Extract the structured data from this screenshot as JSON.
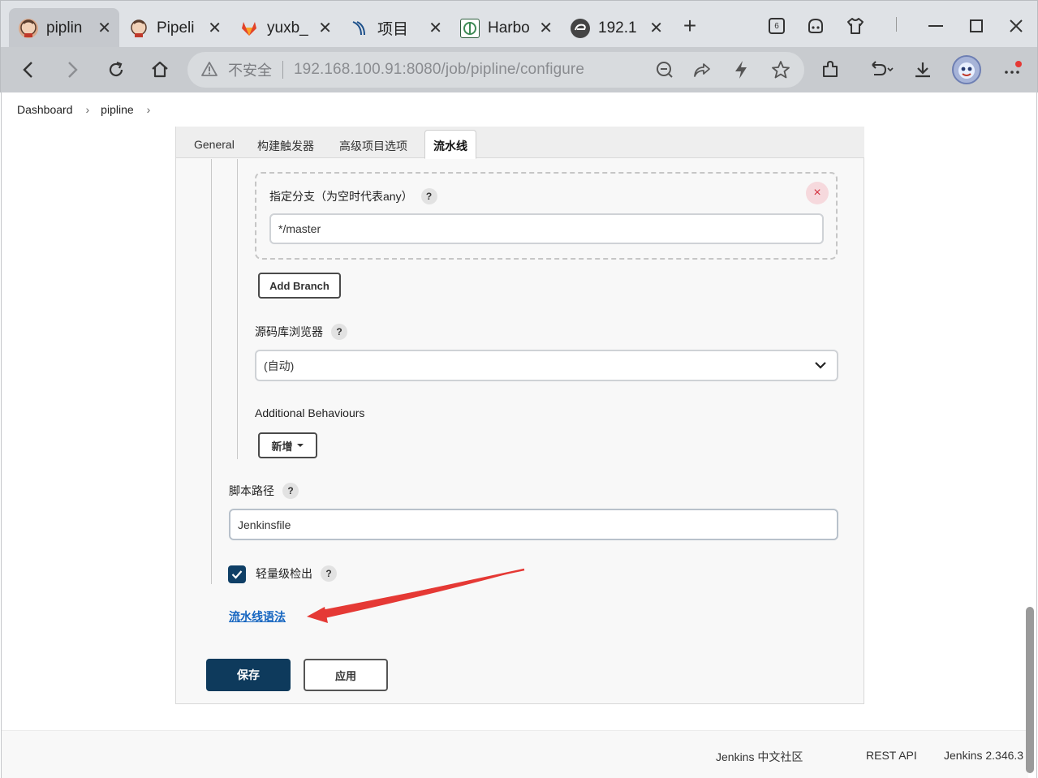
{
  "browser": {
    "tabs": [
      {
        "title": "piplin",
        "active": true,
        "icon": "jenkins-icon"
      },
      {
        "title": "Pipeli",
        "active": false,
        "icon": "jenkins-icon"
      },
      {
        "title": "yuxb_",
        "active": false,
        "icon": "gitlab-icon"
      },
      {
        "title": "项目",
        "active": false,
        "icon": "project-icon"
      },
      {
        "title": "Harbo",
        "active": false,
        "icon": "harbor-icon"
      },
      {
        "title": "192.1",
        "active": false,
        "icon": "edge-icon"
      }
    ],
    "new_tab_label": "+",
    "tab_count": "6",
    "address": {
      "insecure_label": "不安全",
      "url": "192.168.100.91:8080/job/pipline/configure"
    }
  },
  "breadcrumb": {
    "items": [
      "Dashboard",
      "pipline"
    ]
  },
  "config_tabs": [
    "General",
    "构建触发器",
    "高级项目选项",
    "流水线"
  ],
  "branch": {
    "label": "指定分支（为空时代表any）",
    "help": "?",
    "value": "*/master",
    "remove_label": "×"
  },
  "add_branch_label": "Add Branch",
  "repo_browser": {
    "label": "源码库浏览器",
    "help": "?",
    "selected": "(自动)"
  },
  "additional_behaviours": {
    "label": "Additional Behaviours",
    "add_label": "新增"
  },
  "script_path": {
    "label": "脚本路径",
    "help": "?",
    "value": "Jenkinsfile"
  },
  "lightweight_checkout": {
    "label": "轻量级检出",
    "help": "?",
    "checked": true
  },
  "pipeline_syntax_link": "流水线语法",
  "actions": {
    "save_label": "保存",
    "apply_label": "应用"
  },
  "footer": {
    "community": "Jenkins 中文社区",
    "rest_api": "REST API",
    "version": "Jenkins 2.346.3"
  },
  "colors": {
    "primary": "#0e3a5c",
    "link": "#1565c0",
    "annotation_arrow": "#e53935"
  }
}
